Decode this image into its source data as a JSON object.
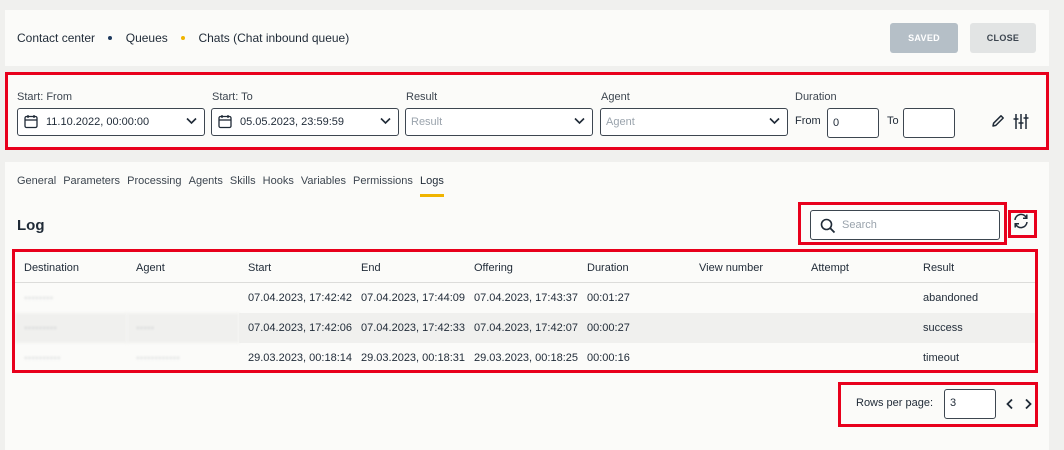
{
  "breadcrumb": {
    "items": [
      "Contact center",
      "Queues",
      "Chats (Chat inbound queue)"
    ],
    "dot_colors": [
      "#1f3a5f",
      "#f0b400"
    ]
  },
  "header": {
    "saved_label": "SAVED",
    "close_label": "CLOSE"
  },
  "filters": {
    "start_from": {
      "label": "Start: From",
      "value": "11.10.2022, 00:00:00"
    },
    "start_to": {
      "label": "Start: To",
      "value": "05.05.2023, 23:59:59"
    },
    "result": {
      "label": "Result",
      "placeholder": "Result"
    },
    "agent": {
      "label": "Agent",
      "placeholder": "Agent"
    },
    "duration": {
      "label": "Duration",
      "from_label": "From",
      "from_value": "0",
      "to_label": "To",
      "to_value": ""
    }
  },
  "tabs": [
    "General",
    "Parameters",
    "Processing",
    "Agents",
    "Skills",
    "Hooks",
    "Variables",
    "Permissions",
    "Logs"
  ],
  "active_tab": "Logs",
  "log": {
    "title": "Log",
    "search_placeholder": "Search",
    "columns": [
      "Destination",
      "Agent",
      "Start",
      "End",
      "Offering",
      "Duration",
      "View number",
      "Attempt",
      "Result"
    ],
    "rows": [
      {
        "destination": "········",
        "agent": "",
        "start": "07.04.2023, 17:42:42",
        "end": "07.04.2023, 17:44:09",
        "offering": "07.04.2023, 17:43:37",
        "duration": "00:01:27",
        "view_number": "",
        "attempt": "",
        "result": "abandoned"
      },
      {
        "destination": "·········",
        "agent": "·····",
        "start": "07.04.2023, 17:42:06",
        "end": "07.04.2023, 17:42:33",
        "offering": "07.04.2023, 17:42:07",
        "duration": "00:00:27",
        "view_number": "",
        "attempt": "",
        "result": "success"
      },
      {
        "destination": "··········",
        "agent": "············",
        "start": "29.03.2023, 00:18:14",
        "end": "29.03.2023, 00:18:31",
        "offering": "29.03.2023, 00:18:25",
        "duration": "00:00:16",
        "view_number": "",
        "attempt": "",
        "result": "timeout"
      }
    ]
  },
  "pagination": {
    "rows_per_page_label": "Rows per page:",
    "rows_per_page_value": "3"
  },
  "colors": {
    "accent": "#f0b400",
    "highlight": "#e8001c",
    "saved_button": "#b5bfc7"
  },
  "icons": [
    "calendar-icon",
    "chevron-down-icon",
    "pencil-icon",
    "sliders-icon",
    "search-icon",
    "refresh-icon",
    "chevron-left-icon",
    "chevron-right-icon"
  ]
}
